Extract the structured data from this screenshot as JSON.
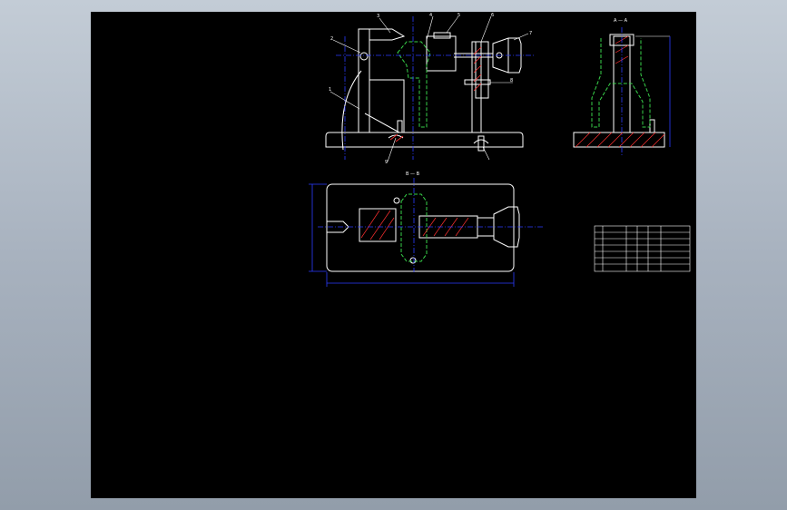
{
  "view_labels": {
    "section_aa": "A — A",
    "section_bb": "B — B"
  },
  "part_numbers": [
    "1",
    "2",
    "3",
    "4",
    "5",
    "6",
    "7",
    "8",
    "9"
  ],
  "colors": {
    "workspace": "#a9b3c0",
    "sheet": "#000000",
    "outline": "#ffffff",
    "dimension": "#2b3bff",
    "hidden_part": "#38d24a",
    "section_hatch": "#ff3030"
  }
}
